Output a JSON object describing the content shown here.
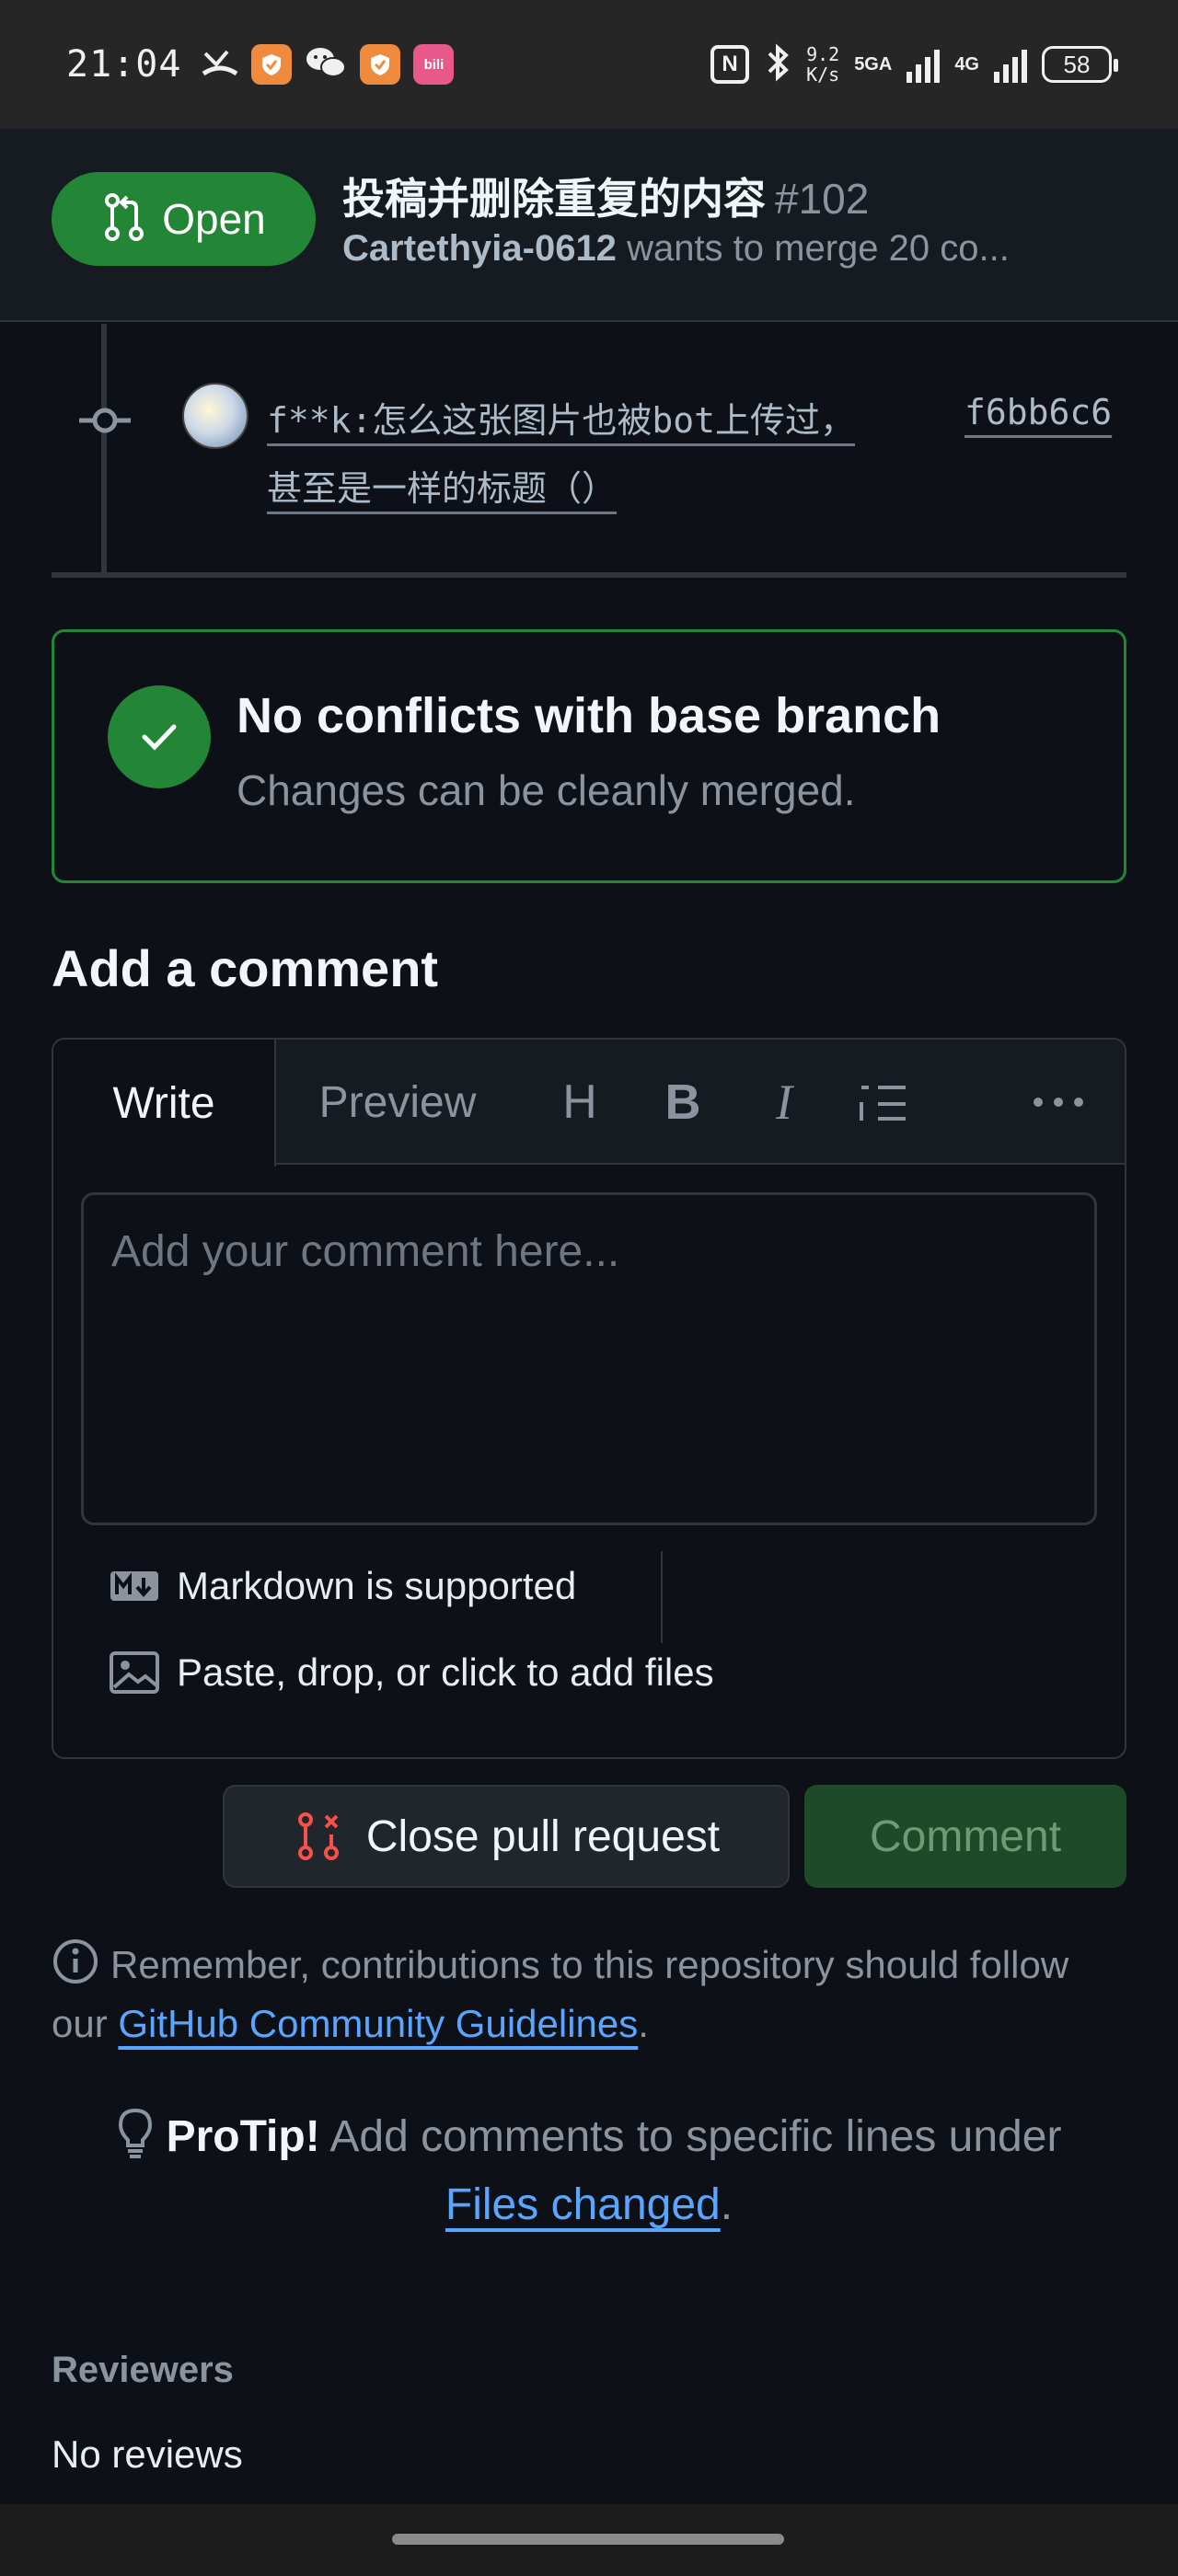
{
  "status_bar": {
    "time": "21:04",
    "nfc": "N",
    "net_speed_value": "9.2",
    "net_speed_unit": "K/s",
    "network_1": "5GA",
    "network_2": "4G",
    "battery": "58",
    "bili_label": "bili"
  },
  "pr": {
    "state": "Open",
    "title": "投稿并删除重复的内容",
    "number": "#102",
    "author": "Cartethyia-0612",
    "merge_text": "wants to merge 20 co..."
  },
  "commit": {
    "message": "f**k:怎么这张图片也被bot上传过，甚至是一样的标题（）",
    "sha": "f6bb6c6"
  },
  "merge_status": {
    "title": "No conflicts with base branch",
    "subtitle": "Changes can be cleanly merged."
  },
  "comment": {
    "heading": "Add a comment",
    "tab_write": "Write",
    "tab_preview": "Preview",
    "placeholder": "Add your comment here...",
    "markdown_note": "Markdown is supported",
    "files_note": "Paste, drop, or click to add files"
  },
  "actions": {
    "close_label": "Close pull request",
    "comment_label": "Comment"
  },
  "remember": {
    "text": "Remember, contributions to this repository should follow our ",
    "link": "GitHub Community Guidelines",
    "end": "."
  },
  "protip": {
    "label": "ProTip!",
    "text": "Add comments to specific lines under",
    "link": "Files changed",
    "end": "."
  },
  "reviewers": {
    "heading": "Reviewers",
    "value": "No reviews"
  },
  "colors": {
    "accent_green": "#238636",
    "link_blue": "#58a6ff",
    "background": "#0d1117"
  }
}
